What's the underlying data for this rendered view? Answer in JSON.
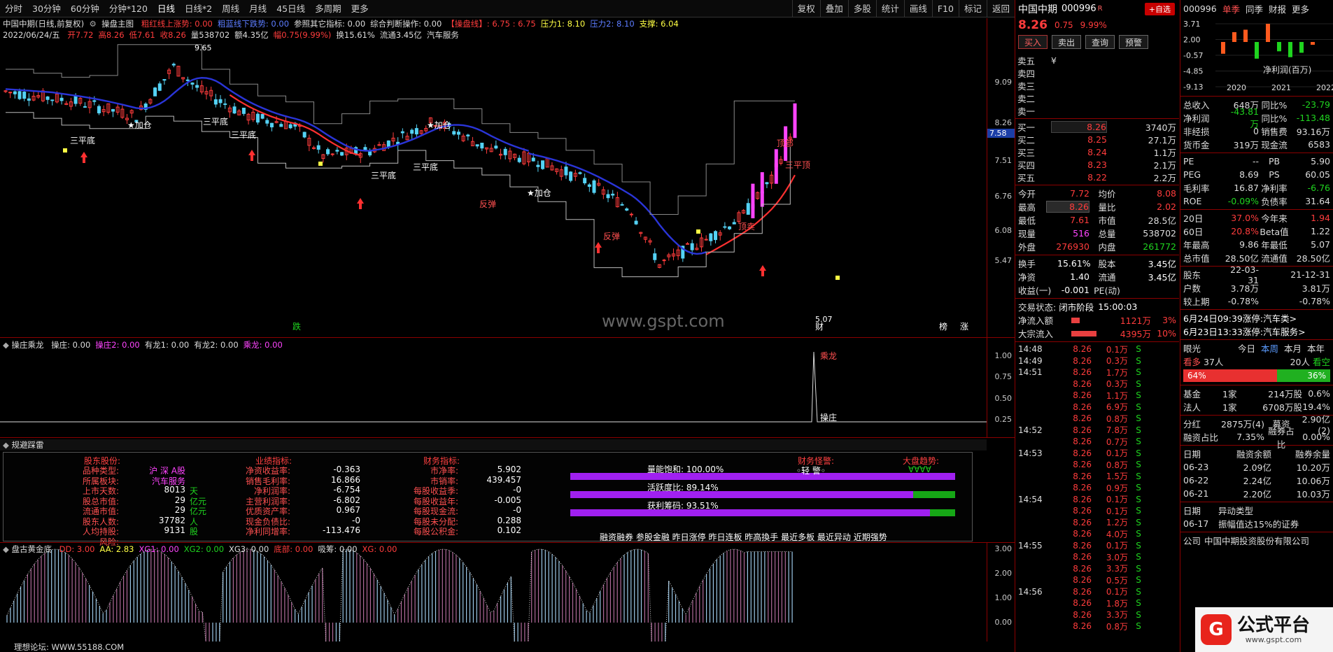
{
  "toolbar": {
    "periods": [
      "分时",
      "30分钟",
      "60分钟",
      "分钟*120",
      "日线",
      "日线*2",
      "周线",
      "月线",
      "45日线",
      "多周期",
      "更多"
    ],
    "right": [
      "复权",
      "叠加",
      "多股",
      "统计",
      "画线",
      "F10",
      "标记",
      "返回"
    ]
  },
  "main": {
    "title": "中国中期(日线,前复权)",
    "indicator": "操盘主图",
    "legend": [
      {
        "text": "粗红线上涨势: 0.00",
        "color": "#ff3c3c"
      },
      {
        "text": "粗蓝线下跌势: 0.00",
        "color": "#5c7cff"
      },
      {
        "text": "参照其它指标: 0.00",
        "color": "#ddd"
      },
      {
        "text": "综合判断操作: 0.00",
        "color": "#ddd"
      },
      {
        "text": "【操盘线】: 6.75 : 6.75",
        "color": "#ff3c3c"
      },
      {
        "text": "压力1: 8.10",
        "color": "#ffff44"
      },
      {
        "text": "压力2: 8.10",
        "color": "#5c7cff"
      },
      {
        "text": "支撑: 6.04",
        "color": "#ffff44"
      }
    ],
    "date_line": "2022/06/24/五",
    "ohlc": [
      {
        "text": "开7.72",
        "color": "#ff3c3c"
      },
      {
        "text": "高8.26",
        "color": "#ff3c3c"
      },
      {
        "text": "低7.61",
        "color": "#ff3c3c"
      },
      {
        "text": "收8.26",
        "color": "#ff3c3c"
      },
      {
        "text": "量538702",
        "color": "#ddd"
      },
      {
        "text": "额4.35亿",
        "color": "#ddd"
      },
      {
        "text": "幅0.75(9.99%)",
        "color": "#ff3c3c"
      },
      {
        "text": "换15.61%",
        "color": "#ddd"
      },
      {
        "text": "流通3.45亿",
        "color": "#ddd"
      },
      {
        "text": "汽车服务",
        "color": "#ddd"
      }
    ],
    "yticks": [
      "9.09",
      "8.26",
      "7.51",
      "6.76",
      "6.08",
      "5.47"
    ],
    "current_price_tag": "7.58",
    "high_label": "9.65",
    "low_label": "5.07",
    "watermark": "www.gspt.com",
    "annotations": [
      "三平底",
      "★加仓",
      "三平底",
      "三平底",
      "三平底",
      "三平底",
      "★加仓",
      "反弹",
      "★加仓",
      "反弹",
      "顶部",
      "三平顶",
      "顶卖",
      "跌",
      "财",
      "榜",
      "涨"
    ]
  },
  "sub1": {
    "name": "操庄乘龙",
    "legend": [
      {
        "text": "操庄: 0.00",
        "color": "#ddd"
      },
      {
        "text": "操庄2: 0.00",
        "color": "#ff44ff"
      },
      {
        "text": "有龙1: 0.00",
        "color": "#ddd"
      },
      {
        "text": "有龙2: 0.00",
        "color": "#ddd"
      },
      {
        "text": "乘龙: 0.00",
        "color": "#ff44ff"
      }
    ],
    "yticks": [
      "1.00",
      "0.75",
      "0.50",
      "0.25"
    ],
    "labels": [
      "乘龙",
      "操庄"
    ]
  },
  "sub2": {
    "name": "规避踩雷",
    "col1_title": "股东股份:",
    "col1": [
      {
        "k": "品种类型:",
        "v": "沪 深 A股",
        "u": ""
      },
      {
        "k": "所属板块:",
        "v": "汽车服务",
        "u": ""
      },
      {
        "k": "上市天数:",
        "v": "8013",
        "u": "天"
      },
      {
        "k": "股总市值:",
        "v": "29",
        "u": "亿元"
      },
      {
        "k": "流通市值:",
        "v": "29",
        "u": "亿元"
      },
      {
        "k": "股东人数:",
        "v": "37782",
        "u": "人"
      },
      {
        "k": "人均持股:",
        "v": "9131",
        "u": "股"
      },
      {
        "k": "风险:",
        "v": "",
        "u": ""
      }
    ],
    "col2_title": "业绩指标:",
    "col2": [
      {
        "k": "净资收益率:",
        "v": "-0.363"
      },
      {
        "k": "销售毛利率:",
        "v": "16.866"
      },
      {
        "k": "净利润率:",
        "v": "-6.754"
      },
      {
        "k": "主营利润率:",
        "v": "-6.802"
      },
      {
        "k": "优质资产率:",
        "v": "0.967"
      },
      {
        "k": "现金负债比:",
        "v": "-0"
      },
      {
        "k": "净利同增率:",
        "v": "-113.476"
      }
    ],
    "col3_title": "财务指标:",
    "col3": [
      {
        "k": "市净率:",
        "v": "5.902"
      },
      {
        "k": "市销率:",
        "v": "439.457"
      },
      {
        "k": "每股收益季:",
        "v": "-0"
      },
      {
        "k": "每股收益年:",
        "v": "-0.005"
      },
      {
        "k": "每股现金流:",
        "v": "-0"
      },
      {
        "k": "每股未分配:",
        "v": "0.288"
      },
      {
        "k": "每股公积金:",
        "v": "0.102"
      }
    ],
    "bars": [
      {
        "label": "量能饱和: 100.00%",
        "pct": 100
      },
      {
        "label": "活跃度比: 89.14%",
        "pct": 89.14
      },
      {
        "label": "获利筹码: 93.51%",
        "pct": 93.51
      }
    ],
    "fin_title": "财务怪警:",
    "fin_value": "◦轻 警◦",
    "market_title": "大盘趋势:",
    "market_value": "∀∀∀∀",
    "bottom_links": "融资融券 参股金融 昨日涨停 昨日连板 昨高換手 最近多板 最近异动 近期强势"
  },
  "sub3": {
    "name": "盘古黄金底",
    "legend": [
      {
        "text": "DD: 3.00",
        "color": "#ff3c3c"
      },
      {
        "text": "AA: 2.83",
        "color": "#ffff44"
      },
      {
        "text": "XG1: 0.00",
        "color": "#ff44ff"
      },
      {
        "text": "XG2: 0.00",
        "color": "#1fd41f"
      },
      {
        "text": "XG3: 0.00",
        "color": "#ddd"
      },
      {
        "text": "底部: 0.00",
        "color": "#ff3c3c"
      },
      {
        "text": "吸筹: 0.00",
        "color": "#ddd"
      },
      {
        "text": "XG: 0.00",
        "color": "#ff3c3c"
      }
    ],
    "yticks": [
      "3.00",
      "2.00",
      "1.00",
      "0.00"
    ]
  },
  "footer": "理想论坛: WWW.55188.COM",
  "quote": {
    "name": "中国中期",
    "code": "000996",
    "mark": "R",
    "add_label": "+自选",
    "price": "8.26",
    "change": "0.75",
    "pct": "9.99%",
    "buttons": [
      "买入",
      "卖出",
      "查询",
      "预警"
    ],
    "sells": [
      {
        "n": "卖五",
        "p": "",
        "v": ""
      },
      {
        "n": "卖四",
        "p": "",
        "v": ""
      },
      {
        "n": "卖三",
        "p": "",
        "v": ""
      },
      {
        "n": "卖二",
        "p": "",
        "v": ""
      },
      {
        "n": "卖一",
        "p": "",
        "v": ""
      }
    ],
    "sell_mark": "¥",
    "buys": [
      {
        "n": "买一",
        "p": "8.26",
        "v": "3740万"
      },
      {
        "n": "买二",
        "p": "8.25",
        "v": "27.1万"
      },
      {
        "n": "买三",
        "p": "8.24",
        "v": "1.1万"
      },
      {
        "n": "买四",
        "p": "8.23",
        "v": "2.1万"
      },
      {
        "n": "买五",
        "p": "8.22",
        "v": "2.2万"
      }
    ],
    "stats": [
      {
        "k": "今开",
        "v": "7.72",
        "vc": "#ff3c3c",
        "k2": "均价",
        "v2": "8.08",
        "v2c": "#ff3c3c"
      },
      {
        "k": "最高",
        "v": "8.26",
        "vc": "#ff3c3c",
        "k2": "量比",
        "v2": "2.02",
        "v2c": "#ff3c3c"
      },
      {
        "k": "最低",
        "v": "7.61",
        "vc": "#ff3c3c",
        "k2": "市值",
        "v2": "28.5亿",
        "v2c": "#ddd"
      },
      {
        "k": "现量",
        "v": "516",
        "vc": "#ff44ff",
        "k2": "总量",
        "v2": "538702",
        "v2c": "#ddd"
      },
      {
        "k": "外盘",
        "v": "276930",
        "vc": "#ff3c3c",
        "k2": "内盘",
        "v2": "261772",
        "v2c": "#1fd41f"
      }
    ],
    "stats2": [
      {
        "k": "换手",
        "v": "15.61%",
        "k2": "股本",
        "v2": "3.45亿"
      },
      {
        "k": "净资",
        "v": "1.40",
        "k2": "流通",
        "v2": "3.45亿"
      },
      {
        "k": "收益(一)",
        "v": "-0.001",
        "k2": "PE(动)",
        "v2": ""
      }
    ],
    "status_label": "交易状态:",
    "status_value": "闭市阶段",
    "status_time": "15:00:03",
    "flows": [
      {
        "k": "净流入额",
        "v": "1121万",
        "p": "3%",
        "bar": 20
      },
      {
        "k": "大宗流入",
        "v": "4395万",
        "p": "10%",
        "bar": 60
      }
    ],
    "ticks": [
      {
        "t": "14:48",
        "p": "8.26",
        "v": "0.1万",
        "s": "S"
      },
      {
        "t": "14:49",
        "p": "8.26",
        "v": "0.3万",
        "s": "S"
      },
      {
        "t": "14:51",
        "p": "8.26",
        "v": "1.7万",
        "s": "S"
      },
      {
        "t": "",
        "p": "8.26",
        "v": "0.3万",
        "s": "S"
      },
      {
        "t": "",
        "p": "8.26",
        "v": "1.1万",
        "s": "S"
      },
      {
        "t": "",
        "p": "8.26",
        "v": "6.9万",
        "s": "S"
      },
      {
        "t": "",
        "p": "8.26",
        "v": "0.8万",
        "s": "S"
      },
      {
        "t": "14:52",
        "p": "8.26",
        "v": "7.8万",
        "s": "S"
      },
      {
        "t": "",
        "p": "8.26",
        "v": "0.7万",
        "s": "S"
      },
      {
        "t": "14:53",
        "p": "8.26",
        "v": "0.1万",
        "s": "S"
      },
      {
        "t": "",
        "p": "8.26",
        "v": "0.8万",
        "s": "S"
      },
      {
        "t": "",
        "p": "8.26",
        "v": "1.5万",
        "s": "S"
      },
      {
        "t": "",
        "p": "8.26",
        "v": "0.9万",
        "s": "S"
      },
      {
        "t": "14:54",
        "p": "8.26",
        "v": "0.1万",
        "s": "S"
      },
      {
        "t": "",
        "p": "8.26",
        "v": "0.1万",
        "s": "S"
      },
      {
        "t": "",
        "p": "8.26",
        "v": "1.2万",
        "s": "S"
      },
      {
        "t": "",
        "p": "8.26",
        "v": "4.0万",
        "s": "S"
      },
      {
        "t": "14:55",
        "p": "8.26",
        "v": "0.1万",
        "s": "S"
      },
      {
        "t": "",
        "p": "8.26",
        "v": "3.0万",
        "s": "S"
      },
      {
        "t": "",
        "p": "8.26",
        "v": "3.3万",
        "s": "S"
      },
      {
        "t": "",
        "p": "8.26",
        "v": "0.5万",
        "s": "S"
      },
      {
        "t": "14:56",
        "p": "8.26",
        "v": "0.1万",
        "s": "S"
      },
      {
        "t": "",
        "p": "8.26",
        "v": "1.8万",
        "s": "S"
      },
      {
        "t": "",
        "p": "8.26",
        "v": "3.3万",
        "s": "S"
      },
      {
        "t": "",
        "p": "8.26",
        "v": "0.8万",
        "s": "S"
      }
    ]
  },
  "f10": {
    "code": "000996",
    "tabs": [
      "单季",
      "同季",
      "财报",
      "更多"
    ],
    "chart_title": "净利润(百万)",
    "mini_yticks": [
      "3.71",
      "2.00",
      "-0.57",
      "-4.85",
      "-9.13"
    ],
    "mini_xticks": [
      "2020",
      "2021",
      "2022"
    ],
    "chart_data": {
      "type": "bar",
      "categories": [
        "2020Q1",
        "2020Q2",
        "2020Q3",
        "2020Q4",
        "2021Q1",
        "2021Q2",
        "2021Q3",
        "2021Q4",
        "2022Q1"
      ],
      "values": [
        -2.4,
        2.0,
        2.5,
        -3.4,
        3.71,
        -1.9,
        -3.1,
        -2.2,
        -0.57
      ]
    },
    "fin": [
      {
        "a": "总收入",
        "b": "648万",
        "c": "同比%",
        "d": "-23.79",
        "bc": "#ddd",
        "dc": "#1fd41f"
      },
      {
        "a": "净利润",
        "b": "-43.81万",
        "c": "同比%",
        "d": "-113.48",
        "bc": "#1fd41f",
        "dc": "#1fd41f"
      },
      {
        "a": "非经损",
        "b": "0",
        "c": "销售费",
        "d": "93.16万",
        "bc": "#ddd",
        "dc": "#ddd"
      },
      {
        "a": "货币金",
        "b": "319万",
        "c": "现金流",
        "d": "6583",
        "bc": "#ddd",
        "dc": "#ddd"
      }
    ],
    "val": [
      {
        "a": "PE",
        "b": "--",
        "c": "PB",
        "d": "5.90",
        "bc": "#ddd",
        "dc": "#ddd"
      },
      {
        "a": "PEG",
        "b": "8.69",
        "c": "PS",
        "d": "60.05",
        "bc": "#ddd",
        "dc": "#ddd"
      },
      {
        "a": "毛利率",
        "b": "16.87",
        "c": "净利率",
        "d": "-6.76",
        "bc": "#ddd",
        "dc": "#1fd41f"
      },
      {
        "a": "ROE",
        "b": "-0.09%",
        "c": "负债率",
        "d": "31.64",
        "bc": "#1fd41f",
        "dc": "#ddd"
      }
    ],
    "perf": [
      {
        "a": "20日",
        "b": "37.0%",
        "c": "今年来",
        "d": "1.94",
        "bc": "#ff3c3c",
        "dc": "#ff3c3c"
      },
      {
        "a": "60日",
        "b": "20.8%",
        "c": "Beta值",
        "d": "1.22",
        "bc": "#ff3c3c",
        "dc": "#ddd"
      },
      {
        "a": "年最高",
        "b": "9.86",
        "c": "年最低",
        "d": "5.07",
        "bc": "#ddd",
        "dc": "#ddd"
      },
      {
        "a": "总市值",
        "b": "28.50亿",
        "c": "流通值",
        "d": "28.50亿",
        "bc": "#ddd",
        "dc": "#ddd"
      }
    ],
    "holders": [
      {
        "a": "股东",
        "b": "22-03-31",
        "d": "21-12-31"
      },
      {
        "a": "户数",
        "b": "3.78万",
        "d": "3.81万"
      },
      {
        "a": "较上期",
        "b": "-0.78%",
        "d": "-0.78%"
      }
    ],
    "news": [
      "6月24日09:39涨停:汽车类>",
      "6月23日13:33涨停:汽车服务>"
    ],
    "eye": {
      "label": "眼光",
      "tabs": [
        "今日",
        "本周",
        "本月",
        "本年"
      ],
      "bull": "看多",
      "bull_n": "37人",
      "bear_n": "20人",
      "bear": "看空",
      "bull_pct": "64%",
      "bear_pct": "36%",
      "bull_frac": 0.64
    },
    "inst": [
      {
        "a": "基金",
        "b": "1家",
        "c": "214万股",
        "d": "0.6%"
      },
      {
        "a": "法人",
        "b": "1家",
        "c": "6708万股",
        "d": "19.4%"
      }
    ],
    "div": {
      "a": "分红",
      "b": "2875万(4)",
      "c": "募资",
      "d": "2.90亿(2)"
    },
    "margin": {
      "a": "融资占比",
      "b": "7.35%",
      "c": "融券占比",
      "d": "0.00%"
    },
    "margin_head": [
      "日期",
      "融资余额",
      "融券余量"
    ],
    "margin_rows": [
      {
        "a": "06-23",
        "b": "2.09亿",
        "d": "10.20万"
      },
      {
        "a": "06-22",
        "b": "2.24亿",
        "d": "10.06万"
      },
      {
        "a": "06-21",
        "b": "2.20亿",
        "d": "10.03万"
      }
    ],
    "abn_head": [
      "日期",
      "异动类型"
    ],
    "abn_rows": [
      {
        "a": "06-17",
        "b": "振幅值达15%的证券"
      }
    ],
    "company_label": "公司",
    "company": "中国中期投资股份有限公司"
  },
  "logo": {
    "title": "公式平台",
    "url": "www.gspt.com"
  }
}
